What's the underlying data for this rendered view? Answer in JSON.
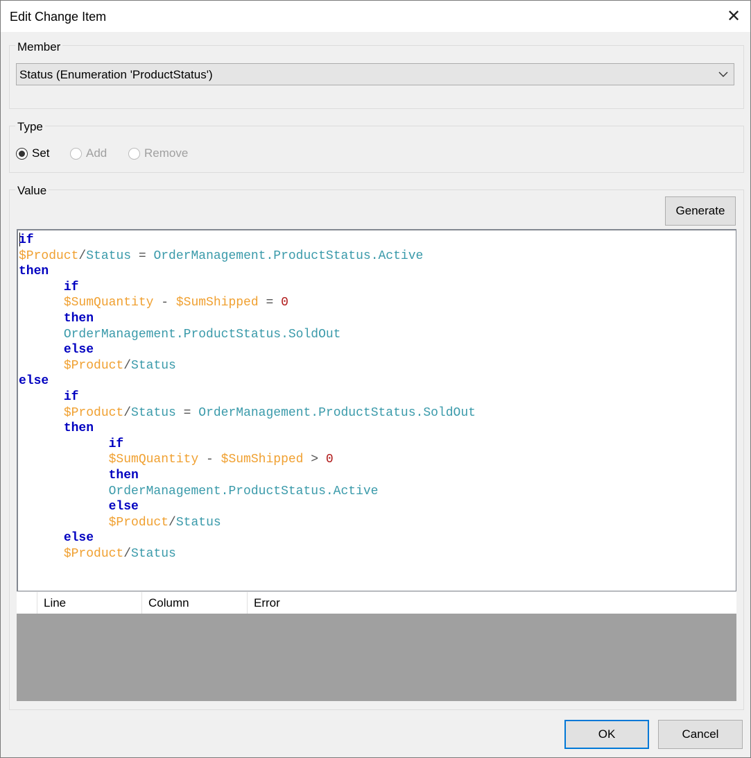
{
  "dialog": {
    "title": "Edit Change Item",
    "close_glyph": "✕"
  },
  "member": {
    "label": "Member",
    "selected": "Status (Enumeration 'ProductStatus')",
    "chevron": "⌵"
  },
  "type": {
    "label": "Type",
    "options": [
      {
        "label": "Set",
        "checked": true,
        "enabled": true
      },
      {
        "label": "Add",
        "checked": false,
        "enabled": false
      },
      {
        "label": "Remove",
        "checked": false,
        "enabled": false
      }
    ]
  },
  "value": {
    "label": "Value",
    "generate_label": "Generate",
    "code_lines": [
      [
        [
          "kw",
          "if"
        ]
      ],
      [
        [
          "var",
          "$Product"
        ],
        [
          "op",
          "/"
        ],
        [
          "id",
          "Status"
        ],
        [
          "op",
          " = "
        ],
        [
          "id",
          "OrderManagement.ProductStatus.Active"
        ]
      ],
      [
        [
          "kw",
          "then"
        ]
      ],
      [
        [
          "op",
          "      "
        ],
        [
          "kw",
          "if"
        ]
      ],
      [
        [
          "op",
          "      "
        ],
        [
          "var",
          "$SumQuantity"
        ],
        [
          "op",
          " - "
        ],
        [
          "var",
          "$SumShipped"
        ],
        [
          "op",
          " = "
        ],
        [
          "num",
          "0"
        ]
      ],
      [
        [
          "op",
          "      "
        ],
        [
          "kw",
          "then"
        ]
      ],
      [
        [
          "op",
          "      "
        ],
        [
          "id",
          "OrderManagement.ProductStatus.SoldOut"
        ]
      ],
      [
        [
          "op",
          "      "
        ],
        [
          "kw",
          "else"
        ]
      ],
      [
        [
          "op",
          "      "
        ],
        [
          "var",
          "$Product"
        ],
        [
          "op",
          "/"
        ],
        [
          "id",
          "Status"
        ]
      ],
      [
        [
          "kw",
          "else"
        ]
      ],
      [
        [
          "op",
          "      "
        ],
        [
          "kw",
          "if"
        ]
      ],
      [
        [
          "op",
          "      "
        ],
        [
          "var",
          "$Product"
        ],
        [
          "op",
          "/"
        ],
        [
          "id",
          "Status"
        ],
        [
          "op",
          " = "
        ],
        [
          "id",
          "OrderManagement.ProductStatus.SoldOut"
        ]
      ],
      [
        [
          "op",
          "      "
        ],
        [
          "kw",
          "then"
        ]
      ],
      [
        [
          "op",
          "            "
        ],
        [
          "kw",
          "if"
        ]
      ],
      [
        [
          "op",
          "            "
        ],
        [
          "var",
          "$SumQuantity"
        ],
        [
          "op",
          " - "
        ],
        [
          "var",
          "$SumShipped"
        ],
        [
          "op",
          " > "
        ],
        [
          "num",
          "0"
        ]
      ],
      [
        [
          "op",
          "            "
        ],
        [
          "kw",
          "then"
        ]
      ],
      [
        [
          "op",
          "            "
        ],
        [
          "id",
          "OrderManagement.ProductStatus.Active"
        ]
      ],
      [
        [
          "op",
          "            "
        ],
        [
          "kw",
          "else"
        ]
      ],
      [
        [
          "op",
          "            "
        ],
        [
          "var",
          "$Product"
        ],
        [
          "op",
          "/"
        ],
        [
          "id",
          "Status"
        ]
      ],
      [
        [
          "op",
          "      "
        ],
        [
          "kw",
          "else"
        ]
      ],
      [
        [
          "op",
          "      "
        ],
        [
          "var",
          "$Product"
        ],
        [
          "op",
          "/"
        ],
        [
          "id",
          "Status"
        ]
      ]
    ]
  },
  "errors": {
    "columns": [
      "Line",
      "Column",
      "Error"
    ],
    "rows": []
  },
  "footer": {
    "ok_label": "OK",
    "cancel_label": "Cancel"
  },
  "colors": {
    "keyword": "#0000c0",
    "variable": "#f0a030",
    "identifier": "#3a9aaa",
    "number": "#b01818",
    "accent": "#0078d7"
  }
}
